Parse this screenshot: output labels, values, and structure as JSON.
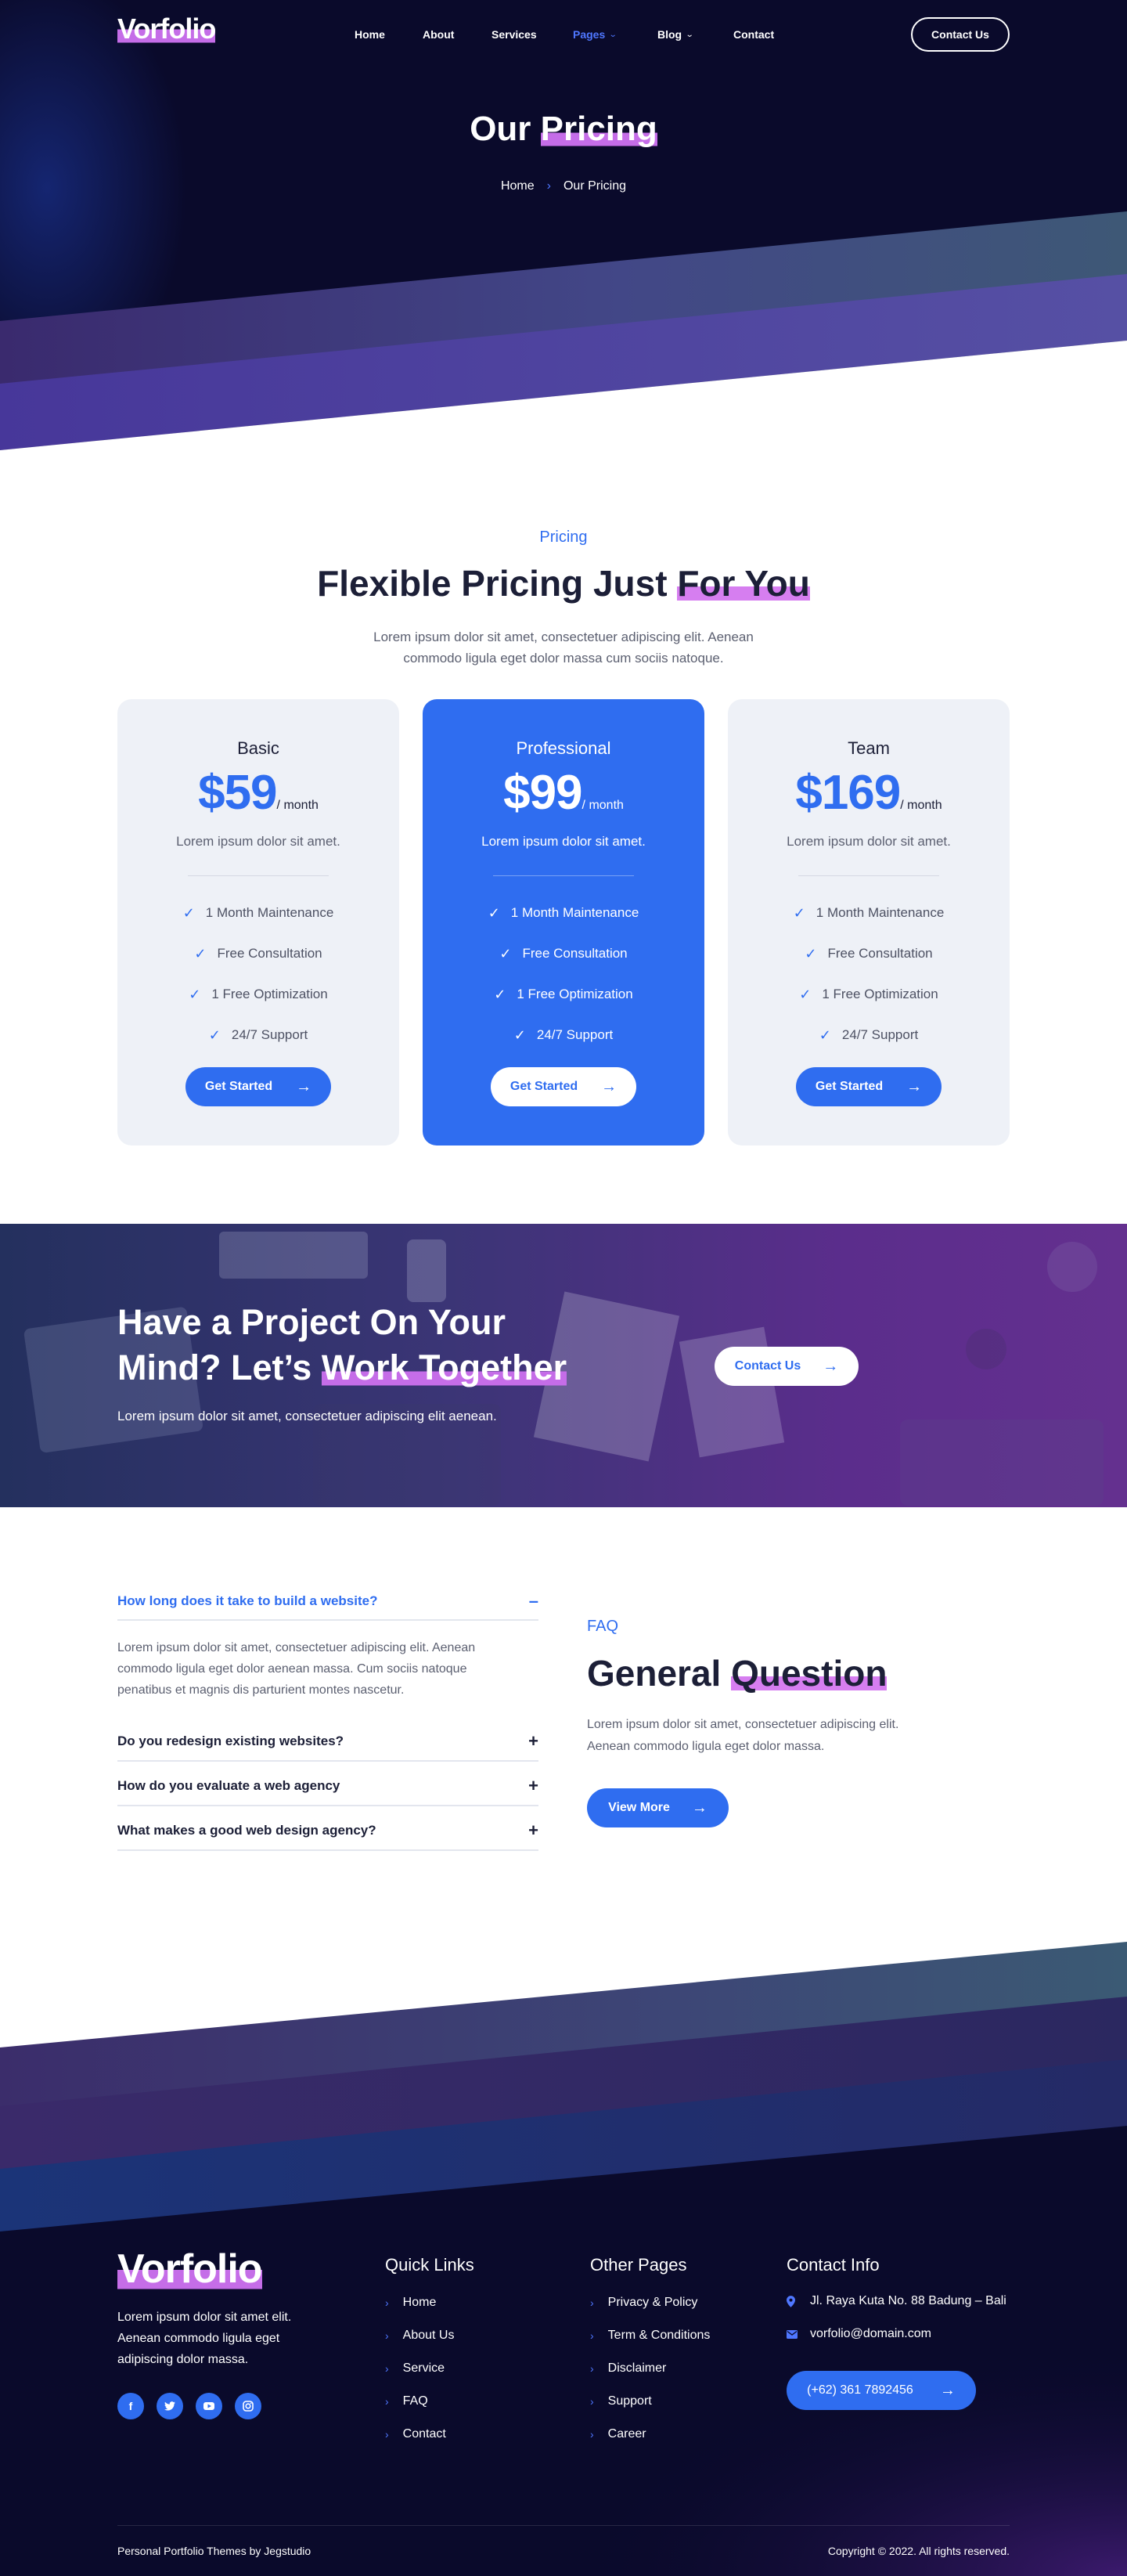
{
  "nav": {
    "logo": "Vorfolio",
    "items": [
      {
        "label": "Home"
      },
      {
        "label": "About"
      },
      {
        "label": "Services"
      },
      {
        "label": "Pages"
      },
      {
        "label": "Blog"
      },
      {
        "label": "Contact"
      }
    ],
    "contact_button": "Contact Us"
  },
  "hero": {
    "title_plain": "Our ",
    "title_highlight": "Pricing",
    "breadcrumb_home": "Home",
    "breadcrumb_current": "Our Pricing"
  },
  "pricing": {
    "subtitle": "Pricing",
    "title_plain": "Flexible Pricing Just ",
    "title_highlight": "For You",
    "description_line1": "Lorem ipsum dolor sit amet, consectetuer adipiscing elit. Aenean",
    "description_line2": "commodo ligula eget dolor massa cum sociis natoque.",
    "plans": [
      {
        "name": "Basic",
        "price": "$59",
        "period": "/ month",
        "desc": "Lorem ipsum dolor sit amet.",
        "features": [
          "1 Month Maintenance",
          "Free Consultation",
          "1 Free Optimization",
          "24/7 Support"
        ],
        "button": "Get Started"
      },
      {
        "name": "Professional",
        "price": "$99",
        "period": "/ month",
        "desc": "Lorem ipsum dolor sit amet.",
        "features": [
          "1 Month Maintenance",
          "Free Consultation",
          "1 Free Optimization",
          "24/7 Support"
        ],
        "button": "Get Started"
      },
      {
        "name": "Team",
        "price": "$169",
        "period": "/ month",
        "desc": "Lorem ipsum dolor sit amet.",
        "features": [
          "1 Month Maintenance",
          "Free Consultation",
          "1 Free Optimization",
          "24/7 Support"
        ],
        "button": "Get Started"
      }
    ]
  },
  "cta": {
    "title_line1": "Have a Project On Your",
    "title_line2_plain": "Mind? Let’s ",
    "title_line2_highlight": "Work Together",
    "description": "Lorem ipsum dolor sit amet, consectetuer adipiscing elit aenean.",
    "button": "Contact Us"
  },
  "faq": {
    "questions": [
      {
        "q": "How long does it take to build a website?",
        "toggle": "–"
      },
      {
        "q": "Do you redesign existing websites?",
        "toggle": "+"
      },
      {
        "q": "How do you evaluate a web agency",
        "toggle": "+"
      },
      {
        "q": "What makes a good web design agency?",
        "toggle": "+"
      }
    ],
    "answer": "Lorem ipsum dolor sit amet, consectetuer adipiscing elit. Aenean commodo ligula eget dolor aenean massa. Cum sociis natoque penatibus et magnis dis parturient montes nascetur.",
    "subtitle": "FAQ",
    "title_plain": "General ",
    "title_highlight": "Question",
    "description_line1": "Lorem ipsum dolor sit amet, consectetuer adipiscing elit.",
    "description_line2": "Aenean commodo ligula eget dolor massa.",
    "button": "View More"
  },
  "footer": {
    "logo": "Vorfolio",
    "description": "Lorem ipsum dolor sit amet elit. Aenean commodo ligula eget adipiscing dolor massa.",
    "social_icons": [
      "facebook-icon",
      "twitter-icon",
      "youtube-icon",
      "instagram-icon"
    ],
    "quick_links_title": "Quick Links",
    "quick_links": [
      "Home",
      "About Us",
      "Service",
      "FAQ",
      "Contact"
    ],
    "other_pages_title": "Other Pages",
    "other_pages": [
      "Privacy & Policy",
      "Term & Conditions",
      "Disclaimer",
      "Support",
      "Career"
    ],
    "contact_title": "Contact Info",
    "address": "Jl. Raya Kuta No. 88 Badung – Bali",
    "email": "vorfolio@domain.com",
    "phone": "(+62) 361 7892456",
    "bottom_left": "Personal Portfolio Themes by Jegstudio",
    "bottom_right": "Copyright © 2022. All rights reserved."
  },
  "colors": {
    "accent": "#2f6df0",
    "highlight": "#d67ef0",
    "dark": "#0a0a2b",
    "text": "#1c1f37"
  }
}
